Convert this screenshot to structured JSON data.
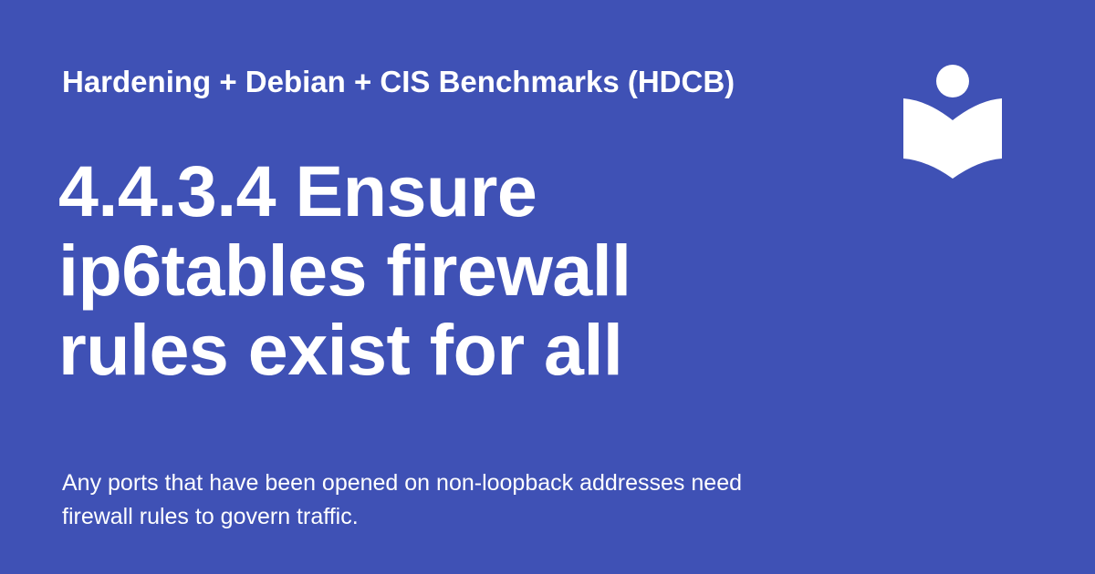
{
  "site": {
    "title": "Hardening + Debian + CIS Benchmarks (HDCB)",
    "logo_icon": "open-book-reader-icon"
  },
  "page": {
    "title_lines": [
      "4.4.3.4 Ensure",
      "ip6tables firewall",
      "rules exist for all"
    ],
    "description": "Any ports that have been opened on non-loopback addresses need firewall rules to govern traffic."
  },
  "colors": {
    "background": "#3f51b5",
    "text": "#ffffff"
  }
}
